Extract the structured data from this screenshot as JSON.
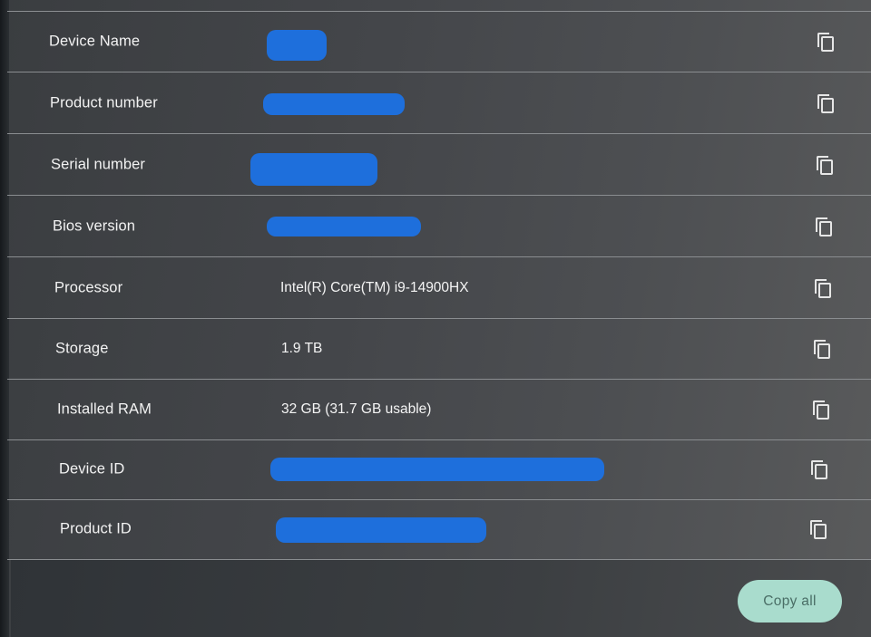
{
  "rows": [
    {
      "label": "Device Name",
      "value": ""
    },
    {
      "label": "Product number",
      "value": ""
    },
    {
      "label": "Serial number",
      "value": ""
    },
    {
      "label": "Bios version",
      "value": ""
    },
    {
      "label": "Processor",
      "value": "Intel(R) Core(TM) i9-14900HX"
    },
    {
      "label": "Storage",
      "value": "1.9 TB"
    },
    {
      "label": "Installed RAM",
      "value": "32 GB (31.7 GB usable)"
    },
    {
      "label": "Device ID",
      "value": ""
    },
    {
      "label": "Product ID",
      "value": ""
    }
  ],
  "copy_all_label": "Copy all",
  "colors": {
    "redaction": "#1e6fdc",
    "copy_all_bg": "#a9dccd"
  }
}
